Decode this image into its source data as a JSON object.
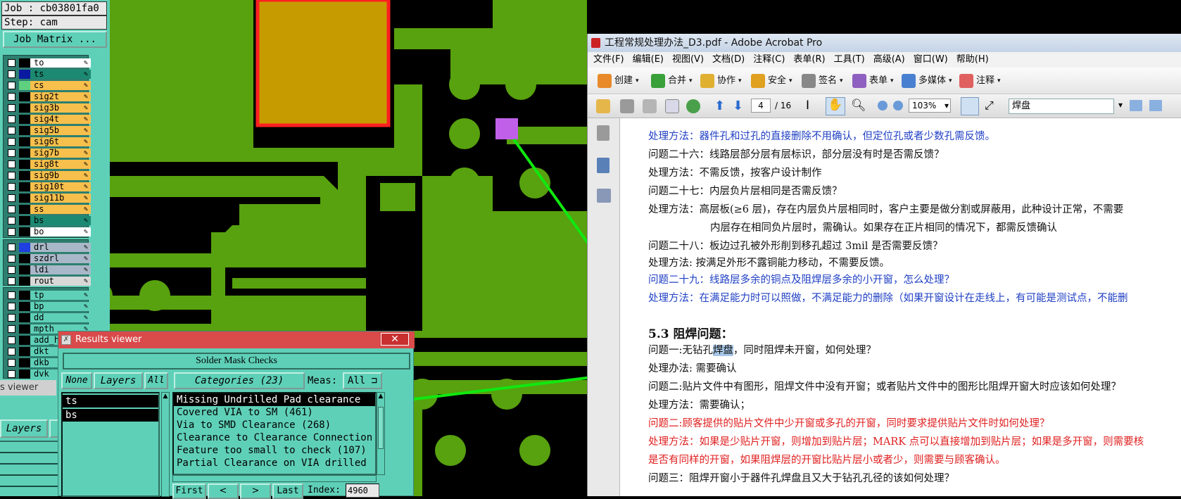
{
  "left_panel": {
    "job": "Job : cb03801fa0",
    "step": "Step: cam",
    "job_matrix": "Job Matrix ...",
    "layers_group1": [
      {
        "name": "to",
        "color": "#ffffff",
        "sw": "#000000"
      },
      {
        "name": "ts",
        "color": "#1c8a72",
        "sw": "#0a1aa0"
      },
      {
        "name": "cs",
        "color": "#f7bf4c",
        "sw": "#5fd080"
      },
      {
        "name": "sig2t",
        "color": "#f7bf4c",
        "sw": "#000000"
      },
      {
        "name": "sig3b",
        "color": "#f7bf4c",
        "sw": "#000000"
      },
      {
        "name": "sig4t",
        "color": "#f7bf4c",
        "sw": "#000000"
      },
      {
        "name": "sig5b",
        "color": "#f7bf4c",
        "sw": "#000000"
      },
      {
        "name": "sig6t",
        "color": "#f7bf4c",
        "sw": "#000000"
      },
      {
        "name": "sig7b",
        "color": "#f7bf4c",
        "sw": "#000000"
      },
      {
        "name": "sig8t",
        "color": "#f7bf4c",
        "sw": "#000000"
      },
      {
        "name": "sig9b",
        "color": "#f7bf4c",
        "sw": "#000000"
      },
      {
        "name": "sig10t",
        "color": "#f7bf4c",
        "sw": "#000000"
      },
      {
        "name": "sig11b",
        "color": "#f7bf4c",
        "sw": "#000000"
      },
      {
        "name": "ss",
        "color": "#f7bf4c",
        "sw": "#000000"
      },
      {
        "name": "bs",
        "color": "#1c8a72",
        "sw": "#000000"
      },
      {
        "name": "bo",
        "color": "#ffffff",
        "sw": "#000000"
      }
    ],
    "layers_group2": [
      {
        "name": "drl",
        "color": "#a9b8c8",
        "sw": "#1f3fe0"
      },
      {
        "name": "szdrl",
        "color": "#a9b8c8",
        "sw": "#000000"
      },
      {
        "name": "ldi",
        "color": "#a9b8c8",
        "sw": "#000000"
      },
      {
        "name": "rout",
        "color": "#d8d8d8",
        "sw": "#000000"
      }
    ],
    "layers_group3": [
      {
        "name": "tp",
        "color": "#5fd0b8",
        "sw": "#000000"
      },
      {
        "name": "bp",
        "color": "#5fd0b8",
        "sw": "#000000"
      },
      {
        "name": "dd",
        "color": "#5fd0b8",
        "sw": "#000000"
      },
      {
        "name": "mpth",
        "color": "#5fd0b8",
        "sw": "#000000"
      },
      {
        "name": "add_he",
        "color": "#5fd0b8",
        "sw": "#000000"
      },
      {
        "name": "dkt",
        "color": "#5fd0b8",
        "sw": "#000000"
      },
      {
        "name": "dkb",
        "color": "#5fd0b8",
        "sw": "#000000"
      },
      {
        "name": "dvk",
        "color": "#5fd0b8",
        "sw": "#000000"
      }
    ],
    "viewer_label": "s viewer",
    "layers_tab": "Layers"
  },
  "results_viewer": {
    "title": "Results viewer",
    "close": "✕",
    "header": "Solder Mask Checks",
    "none_btn": "None",
    "layers_btn": "Layers",
    "all_btn": "All",
    "categories_btn": "Categories (23)",
    "meas_label": "Meas:",
    "meas_value": "All",
    "layers": [
      "ts",
      "bs"
    ],
    "categories": [
      "Missing Undrilled Pad clearance",
      "Covered VIA to SM (461)",
      "Via to SMD Clearance (268)",
      "Clearance to Clearance Connection",
      "Feature too small to check (107)",
      "Partial Clearance on VIA drilled"
    ],
    "first_btn": "First",
    "last_btn": "Last",
    "index_label": "Index:",
    "index_value": "4960"
  },
  "acrobat": {
    "title": "工程常规处理办法_D3.pdf - Adobe Acrobat Pro",
    "menu": [
      "文件(F)",
      "编辑(E)",
      "视图(V)",
      "文档(D)",
      "注释(C)",
      "表单(R)",
      "工具(T)",
      "高级(A)",
      "窗口(W)",
      "帮助(H)"
    ],
    "toolbar1": [
      "创建",
      "合并",
      "协作",
      "安全",
      "签名",
      "表单",
      "多媒体",
      "注释"
    ],
    "page_current": "4",
    "page_total": "/ 16",
    "zoom": "103%",
    "search": "焊盘",
    "lines": [
      {
        "t": "处理方法：器件孔和过孔的直接删除不用确认，但定位孔或者少数孔需反馈。",
        "c": "blue"
      },
      {
        "t": "问题二十六：线路层部分层有层标识，部分层没有时是否需反馈？",
        "c": "black"
      },
      {
        "t": "处理方法：不需反馈，按客户设计制作",
        "c": "black"
      },
      {
        "t": "问题二十七：内层负片层相同是否需反馈？",
        "c": "black"
      },
      {
        "t": "处理方法：高层板(≥6 层)，存在内层负片层相同时，客户主要是做分割或屏蔽用，此种设计正常，不需要",
        "c": "black"
      },
      {
        "t": "内层存在相同负片层时，需确认。如果存在正片相同的情况下，都需反馈确认",
        "c": "black"
      },
      {
        "t": "问题二十八：板边过孔被外形削到移孔超过 3mil 是否需要反馈？",
        "c": "black"
      },
      {
        "t": "处理方法:  按满足外形不露铜能力移动，不需要反馈。",
        "c": "black"
      },
      {
        "t": "问题二十九：线路层多余的铜点及阻焊层多余的小开窗，怎么处理？",
        "c": "blue"
      },
      {
        "t": "处理方法：在满足能力时可以照做，不满足能力的删除（如果开窗设计在走线上，有可能是测试点，不能删",
        "c": "blue"
      },
      {
        "t": "5.3 阻焊问题：",
        "c": "black"
      },
      {
        "t": "问题一:无钻孔焊盘，同时阻焊未开窗，如何处理？",
        "c": "black"
      },
      {
        "t": "处理办法: 需要确认",
        "c": "black"
      },
      {
        "t": "问题二:贴片文件中有图形，阻焊文件中没有开窗；或者贴片文件中的图形比阻焊开窗大时应该如何处理？",
        "c": "black"
      },
      {
        "t": "处理方法：需要确认；",
        "c": "black"
      },
      {
        "t": "问题二:顾客提供的贴片文件中少开窗或多孔的开窗，同时要求提供贴片文件时如何处理？",
        "c": "red"
      },
      {
        "t": "处理方法：如果是少贴片开窗，则增加到贴片层；MARK 点可以直接增加到贴片层；如果是多开窗，则需要核",
        "c": "red"
      },
      {
        "t": "是否有同样的开窗，如果阻焊层的开窗比贴片层小或者少，则需要与顾客确认。",
        "c": "red"
      },
      {
        "t": "问题三：阻焊开窗小于器件孔焊盘且又大于钻孔孔径的该如何处理？",
        "c": "black"
      }
    ]
  },
  "colors": {
    "cad_green": "#58a10f",
    "cad_black": "#000000",
    "pad_gold": "#c69b00",
    "pad_outline_red": "#ff2020",
    "marker_purple": "#c060e8",
    "arrow_green": "#10e810",
    "panel_teal": "#5fd0b8"
  }
}
